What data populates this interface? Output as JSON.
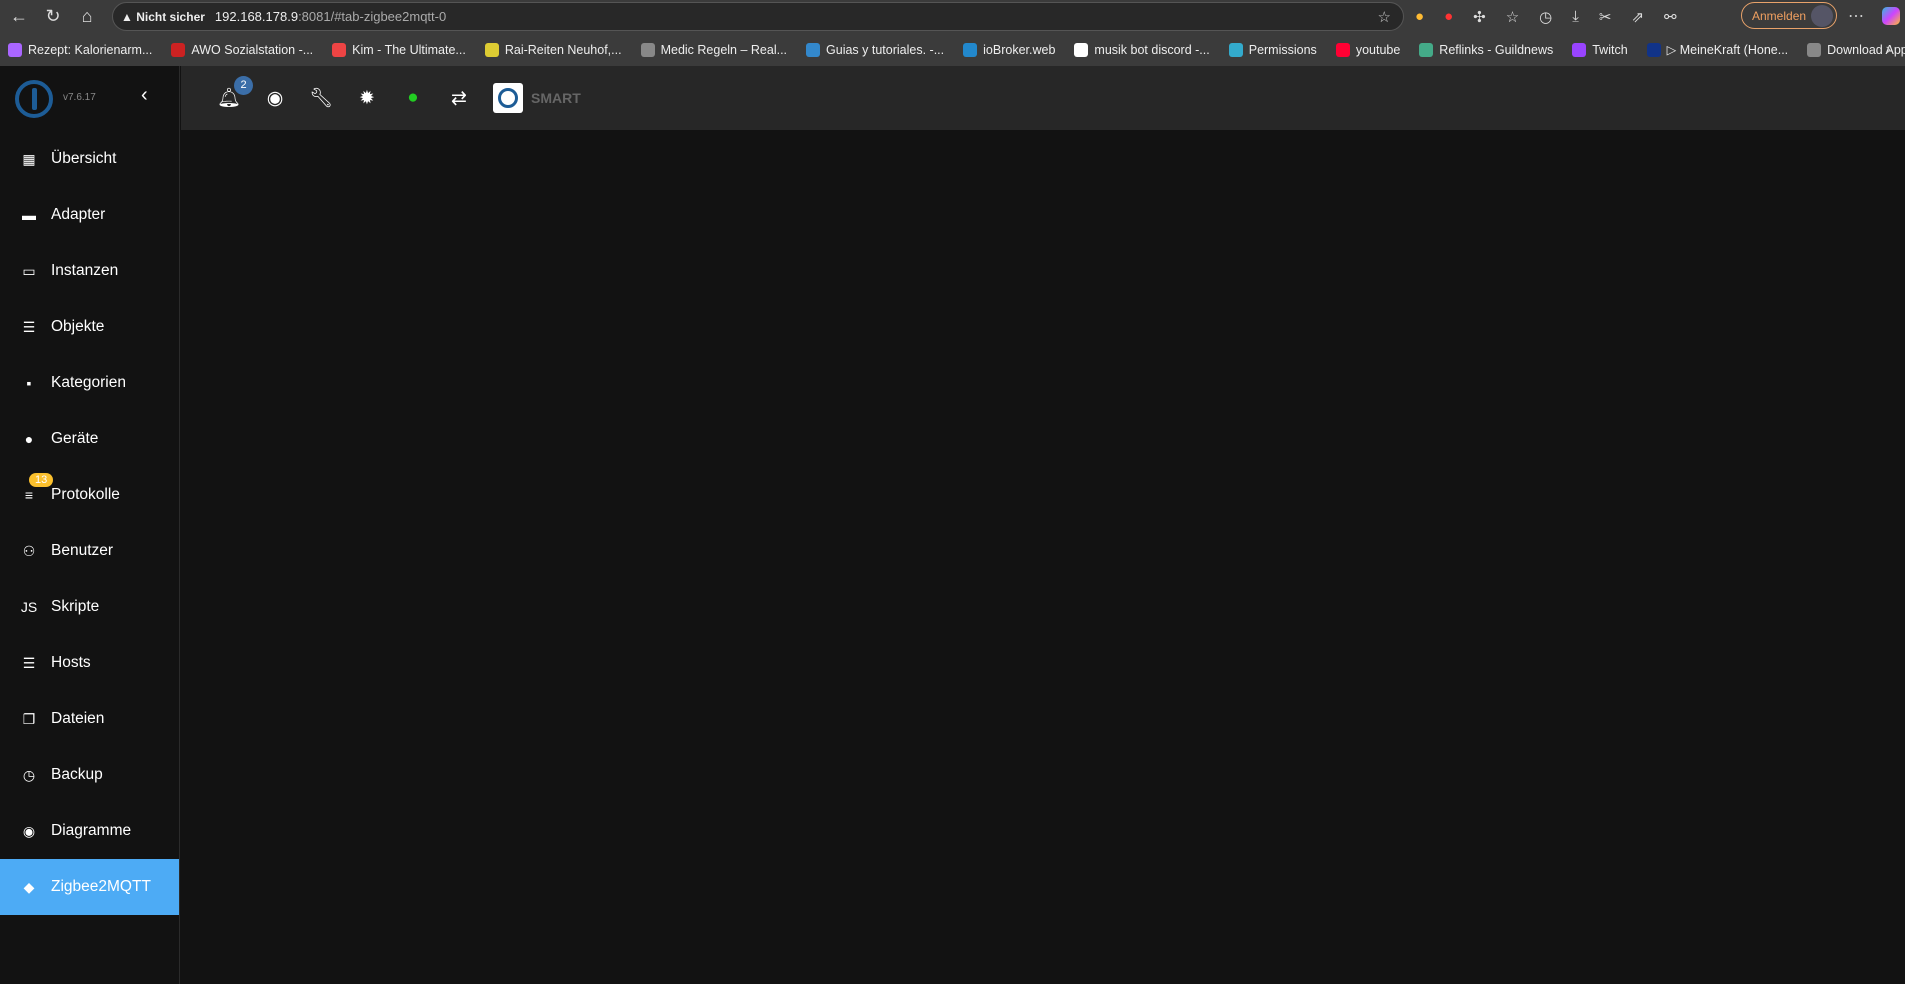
{
  "browser": {
    "security_label": "Nicht sicher",
    "url_host": "192.168.178.9",
    "url_rest": ":8081/#tab-zigbee2mqtt-0",
    "login_label": "Anmelden",
    "bookmarks": [
      {
        "label": "Rezept: Kalorienarm...",
        "color": "#a6f"
      },
      {
        "label": "AWO Sozialstation -...",
        "color": "#c22"
      },
      {
        "label": "Kim - The Ultimate...",
        "color": "#e44"
      },
      {
        "label": "Rai-Reiten Neuhof,...",
        "color": "#dc3"
      },
      {
        "label": "Medic Regeln – Real...",
        "color": "#888"
      },
      {
        "label": "Guias y tutoriales. -...",
        "color": "#38c"
      },
      {
        "label": "ioBroker.web",
        "color": "#28c"
      },
      {
        "label": "musik bot discord -...",
        "color": "#fff"
      },
      {
        "label": "Permissions",
        "color": "#3ac"
      },
      {
        "label": "youtube",
        "color": "#f03"
      },
      {
        "label": "Reflinks - Guildnews",
        "color": "#4a8"
      },
      {
        "label": "Twitch",
        "color": "#94f"
      },
      {
        "label": "▷ MeineKraft (Hone...",
        "color": "#138"
      },
      {
        "label": "Download App",
        "color": "#888"
      }
    ]
  },
  "app": {
    "version": "v7.6.17",
    "notifications_count": "2",
    "smart_label": "SMART",
    "menu": [
      {
        "label": "Übersicht",
        "icon": "apps-icon",
        "glyph": "▦"
      },
      {
        "label": "Adapter",
        "icon": "store-icon",
        "glyph": "▬"
      },
      {
        "label": "Instanzen",
        "icon": "instances-icon",
        "glyph": "▭"
      },
      {
        "label": "Objekte",
        "icon": "list-icon",
        "glyph": "☰"
      },
      {
        "label": "Kategorien",
        "icon": "category-icon",
        "glyph": "▪"
      },
      {
        "label": "Geräte",
        "icon": "devices-icon",
        "glyph": "●"
      },
      {
        "label": "Protokolle",
        "icon": "logs-icon",
        "glyph": "≡",
        "badge": "13"
      },
      {
        "label": "Benutzer",
        "icon": "user-icon",
        "glyph": "⚇"
      },
      {
        "label": "Skripte",
        "icon": "js-icon",
        "glyph": "JS"
      },
      {
        "label": "Hosts",
        "icon": "hosts-icon",
        "glyph": "☰"
      },
      {
        "label": "Dateien",
        "icon": "files-icon",
        "glyph": "❐"
      },
      {
        "label": "Backup",
        "icon": "backup-icon",
        "glyph": "◷"
      },
      {
        "label": "Diagramme",
        "icon": "charts-icon",
        "glyph": "◉"
      },
      {
        "label": "Zigbee2MQTT",
        "icon": "zigbee-icon",
        "glyph": "◆",
        "active": true
      }
    ]
  }
}
